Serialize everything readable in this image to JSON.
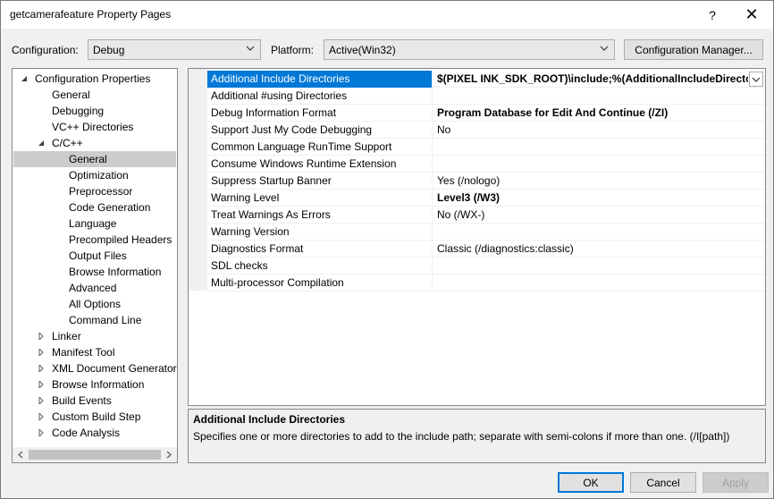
{
  "window": {
    "title": "getcamerafeature Property Pages",
    "help_glyph": "?",
    "close_glyph": "✕"
  },
  "toolbar": {
    "configuration_label": "Configuration:",
    "configuration_value": "Debug",
    "platform_label": "Platform:",
    "platform_value": "Active(Win32)",
    "config_manager_label": "Configuration Manager..."
  },
  "tree": {
    "items": [
      {
        "label": "Configuration Properties",
        "twisty": "expanded"
      },
      {
        "label": "General",
        "twisty": "none"
      },
      {
        "label": "Debugging",
        "twisty": "none"
      },
      {
        "label": "VC++ Directories",
        "twisty": "none"
      },
      {
        "label": "C/C++",
        "twisty": "expanded"
      },
      {
        "label": "General",
        "twisty": "none",
        "selected": true
      },
      {
        "label": "Optimization",
        "twisty": "none"
      },
      {
        "label": "Preprocessor",
        "twisty": "none"
      },
      {
        "label": "Code Generation",
        "twisty": "none"
      },
      {
        "label": "Language",
        "twisty": "none"
      },
      {
        "label": "Precompiled Headers",
        "twisty": "none"
      },
      {
        "label": "Output Files",
        "twisty": "none"
      },
      {
        "label": "Browse Information",
        "twisty": "none"
      },
      {
        "label": "Advanced",
        "twisty": "none"
      },
      {
        "label": "All Options",
        "twisty": "none"
      },
      {
        "label": "Command Line",
        "twisty": "none"
      },
      {
        "label": "Linker",
        "twisty": "collapsed"
      },
      {
        "label": "Manifest Tool",
        "twisty": "collapsed"
      },
      {
        "label": "XML Document Generator",
        "twisty": "collapsed"
      },
      {
        "label": "Browse Information",
        "twisty": "collapsed"
      },
      {
        "label": "Build Events",
        "twisty": "collapsed"
      },
      {
        "label": "Custom Build Step",
        "twisty": "collapsed"
      },
      {
        "label": "Code Analysis",
        "twisty": "collapsed"
      }
    ]
  },
  "grid": {
    "rows": [
      {
        "name": "Additional Include Directories",
        "value": "$(PIXEL INK_SDK_ROOT)\\include;%(AdditionalIncludeDirectories)",
        "bold": true,
        "selected": true
      },
      {
        "name": "Additional #using Directories",
        "value": "",
        "bold": false
      },
      {
        "name": "Debug Information Format",
        "value": "Program Database for Edit And Continue (/ZI)",
        "bold": true
      },
      {
        "name": "Support Just My Code Debugging",
        "value": "No",
        "bold": false
      },
      {
        "name": "Common Language RunTime Support",
        "value": "",
        "bold": false
      },
      {
        "name": "Consume Windows Runtime Extension",
        "value": "",
        "bold": false
      },
      {
        "name": "Suppress Startup Banner",
        "value": "Yes (/nologo)",
        "bold": false
      },
      {
        "name": "Warning Level",
        "value": "Level3 (/W3)",
        "bold": true
      },
      {
        "name": "Treat Warnings As Errors",
        "value": "No (/WX-)",
        "bold": false
      },
      {
        "name": "Warning Version",
        "value": "",
        "bold": false
      },
      {
        "name": "Diagnostics Format",
        "value": "Classic (/diagnostics:classic)",
        "bold": false
      },
      {
        "name": "SDL checks",
        "value": "",
        "bold": false
      },
      {
        "name": "Multi-processor Compilation",
        "value": "",
        "bold": false
      }
    ]
  },
  "description": {
    "title": "Additional Include Directories",
    "text": "Specifies one or more directories to add to the include path; separate with semi-colons if more than one.     (/I[path])"
  },
  "footer": {
    "ok_label": "OK",
    "cancel_label": "Cancel",
    "apply_label": "Apply"
  },
  "colors": {
    "selection": "#0078d7",
    "tree_selection": "#cccccc",
    "accent_button_border": "#0078d7"
  }
}
